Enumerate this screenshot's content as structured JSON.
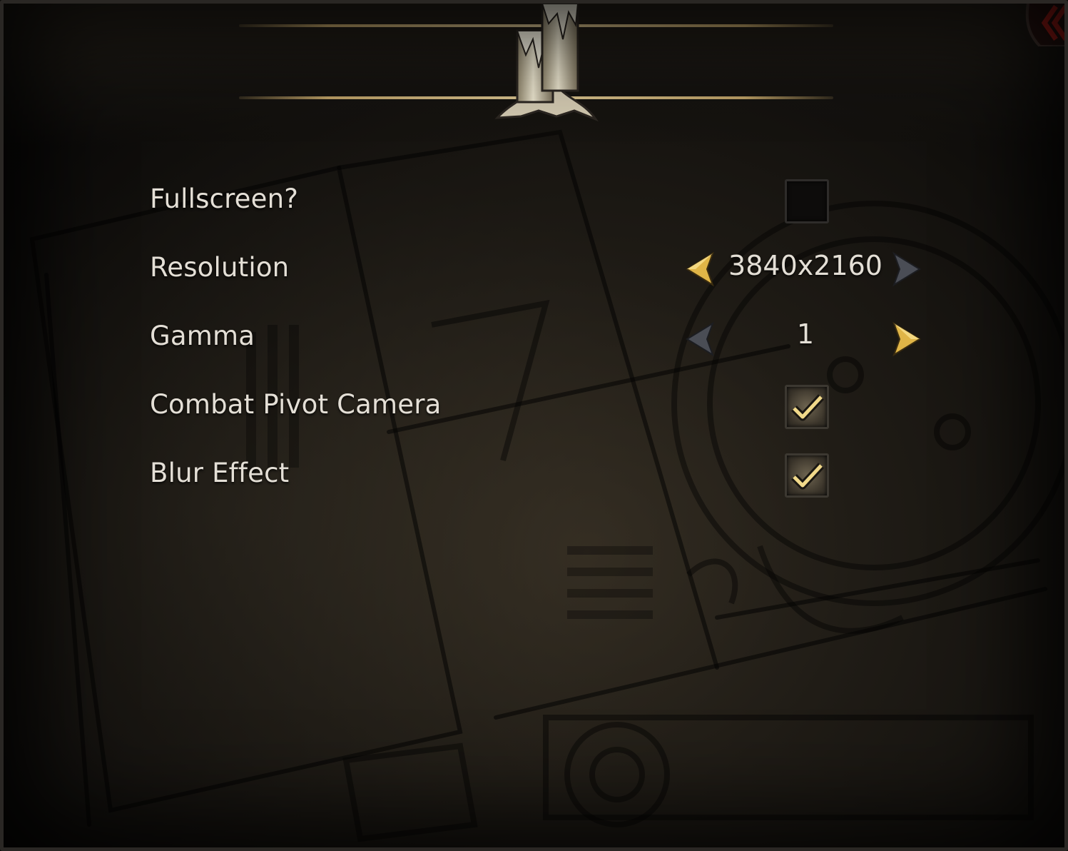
{
  "settings": {
    "fullscreen": {
      "label": "Fullscreen?",
      "checked": false
    },
    "resolution": {
      "label": "Resolution",
      "value": "3840x2160"
    },
    "gamma": {
      "label": "Gamma",
      "value": "1"
    },
    "combat_pivot_camera": {
      "label": "Combat Pivot Camera",
      "checked": true
    },
    "blur_effect": {
      "label": "Blur Effect",
      "checked": true
    }
  },
  "colors": {
    "accent_gold": "#e0b547",
    "arrow_disabled": "#4a4d55",
    "text": "#e4dfd6"
  },
  "icons": {
    "header": "candle-ornament-icon",
    "close": "close-chevron-icon",
    "prev": "arrow-left-icon",
    "next": "arrow-right-icon",
    "check": "checkmark-icon"
  }
}
